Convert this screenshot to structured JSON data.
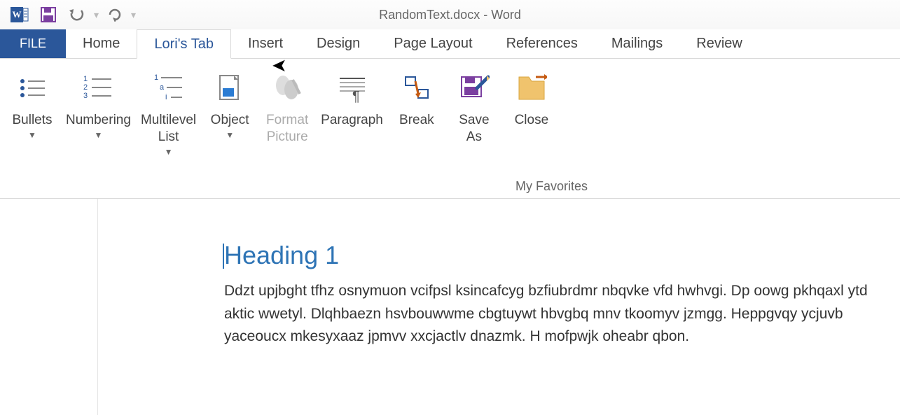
{
  "title": "RandomText.docx - Word",
  "qat": {
    "save": "Save",
    "undo": "Undo",
    "redo": "Redo"
  },
  "tabs": {
    "file": "FILE",
    "home": "Home",
    "custom": "Lori's Tab",
    "insert": "Insert",
    "design": "Design",
    "pagelayout": "Page Layout",
    "references": "References",
    "mailings": "Mailings",
    "review": "Review"
  },
  "ribbon": {
    "group_label": "My Favorites",
    "bullets": "Bullets",
    "numbering": "Numbering",
    "multilevel": "Multilevel\nList",
    "object": "Object",
    "format_picture": "Format\nPicture",
    "paragraph": "Paragraph",
    "break": "Break",
    "save_as": "Save\nAs",
    "close": "Close"
  },
  "document": {
    "heading": "Heading 1",
    "body": "Ddzt upjbght tfhz osnymuon vcifpsl ksincafcyg bzfiubrdmr nbqvke vfd hwhvgi. Dp oowg pkhqaxl ytd aktic wwetyl. Dlqhbaezn hsvbouwwme cbgtuywt hbvgbq mnv tkoomyv jzmgg. Heppgvqy ycjuvb yaceoucx mkesyxaaz jpmvv xxcjactlv dnazmk. H mofpwjk oheabr qbon."
  },
  "colors": {
    "accent": "#2b579a",
    "heading": "#2e74b5",
    "save_purple": "#7b3fa0",
    "folder": "#f0c36d"
  }
}
